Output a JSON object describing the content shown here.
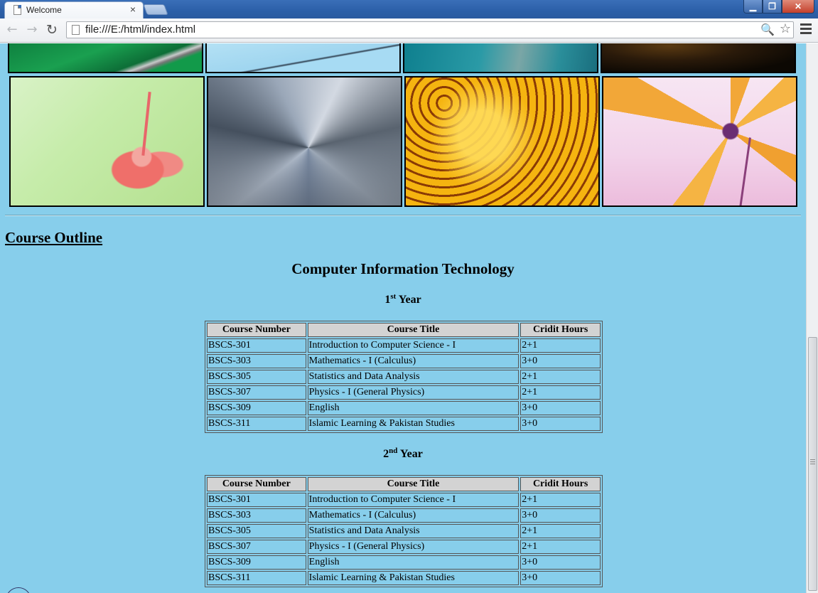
{
  "browser": {
    "tab_title": "Welcome",
    "tab_close": "×",
    "url": "file:///E:/html/index.html",
    "icons": {
      "back": "←",
      "forward": "→",
      "reload": "↻",
      "zoom": "🔍",
      "bookmark": "☆",
      "minimize": "▁",
      "maximize": "❐",
      "close": "✕"
    }
  },
  "page": {
    "background_color": "#87ceeb",
    "gallery": {
      "row1": [
        "green-abstract-image",
        "sky-glass-image",
        "teal-blur-image",
        "dark-bokeh-image"
      ],
      "row2": [
        "pink-flower-image",
        "city-tunnel-image",
        "honeycomb-image",
        "orange-flower-image"
      ]
    },
    "section_heading": "Course Outline",
    "program_title": "Computer Information Technology",
    "years": [
      {
        "number": "1",
        "suffix": "st",
        "label": "Year",
        "headers": [
          "Course Number",
          "Course Title",
          "Cridit Hours"
        ],
        "rows": [
          [
            "BSCS-301",
            "Introduction to Computer Science - I",
            "2+1"
          ],
          [
            "BSCS-303",
            "Mathematics - I (Calculus)",
            "3+0"
          ],
          [
            "BSCS-305",
            "Statistics and Data Analysis",
            "2+1"
          ],
          [
            "BSCS-307",
            "Physics - I (General Physics)",
            "2+1"
          ],
          [
            "BSCS-309",
            "English",
            "3+0"
          ],
          [
            "BSCS-311",
            "Islamic Learning & Pakistan Studies",
            "3+0"
          ]
        ]
      },
      {
        "number": "2",
        "suffix": "nd",
        "label": "Year",
        "headers": [
          "Course Number",
          "Course Title",
          "Cridit Hours"
        ],
        "rows": [
          [
            "BSCS-301",
            "Introduction to Computer Science - I",
            "2+1"
          ],
          [
            "BSCS-303",
            "Mathematics - I (Calculus)",
            "3+0"
          ],
          [
            "BSCS-305",
            "Statistics and Data Analysis",
            "2+1"
          ],
          [
            "BSCS-307",
            "Physics - I (General Physics)",
            "2+1"
          ],
          [
            "BSCS-309",
            "English",
            "3+0"
          ],
          [
            "BSCS-311",
            "Islamic Learning & Pakistan Studies",
            "3+0"
          ]
        ]
      }
    ]
  }
}
